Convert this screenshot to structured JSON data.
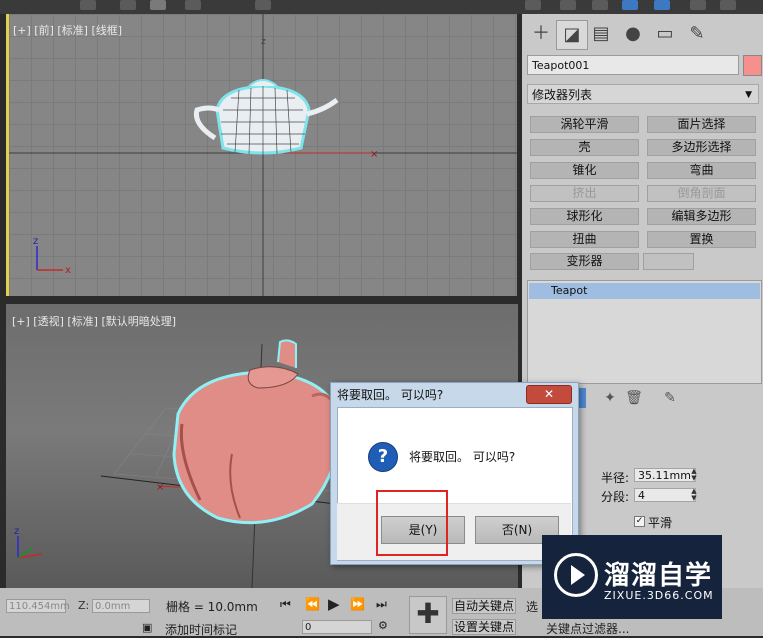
{
  "viewport_front": {
    "label": "[+] [前] [标准] [线框]",
    "axis_z": "z"
  },
  "viewport_perspective": {
    "label": "[+] [透视] [标准] [默认明暗处理]"
  },
  "command_panel": {
    "tabs": [
      "create-icon",
      "modify-icon",
      "hierarchy-icon",
      "motion-icon",
      "display-icon",
      "utilities-icon"
    ],
    "object_name": "Teapot001",
    "object_color": "#f5908c",
    "modifier_list_label": "修改器列表",
    "modifier_buttons": [
      {
        "label": "涡轮平滑",
        "enabled": true
      },
      {
        "label": "面片选择",
        "enabled": true
      },
      {
        "label": "壳",
        "enabled": true
      },
      {
        "label": "多边形选择",
        "enabled": true
      },
      {
        "label": "锥化",
        "enabled": true
      },
      {
        "label": "弯曲",
        "enabled": true
      },
      {
        "label": "挤出",
        "enabled": false
      },
      {
        "label": "倒角剖面",
        "enabled": false
      },
      {
        "label": "球形化",
        "enabled": true
      },
      {
        "label": "编辑多边形",
        "enabled": true
      },
      {
        "label": "扭曲",
        "enabled": true
      },
      {
        "label": "置换",
        "enabled": true
      },
      {
        "label": "变形器",
        "enabled": true
      }
    ],
    "stack_items": [
      "Teapot"
    ],
    "params": {
      "radius_label": "半径:",
      "radius_value": "35.11mm",
      "segments_label": "分段:",
      "segments_value": "4",
      "smooth_label": "平滑",
      "smooth_checked": "✓"
    }
  },
  "dialog": {
    "title": "将要取回。 可以吗?",
    "message": "将要取回。 可以吗?",
    "close_label": "✕",
    "yes_label": "是(Y)",
    "no_label": "否(N)"
  },
  "bottom_bar": {
    "x_value": "110.454mm",
    "z_label": "Z:",
    "z_value": "0.0mm",
    "grid_text": "栅格 = 10.0mm",
    "add_time_tag": "添加时间标记",
    "auto_key": "自动关键点",
    "set_key": "设置关键点",
    "selected_short": "选",
    "key_filters": "关键点过滤器...",
    "frame_value": "0"
  },
  "watermark": {
    "title": "溜溜自学",
    "subtitle": "ZIXUE.3D66.COM"
  }
}
